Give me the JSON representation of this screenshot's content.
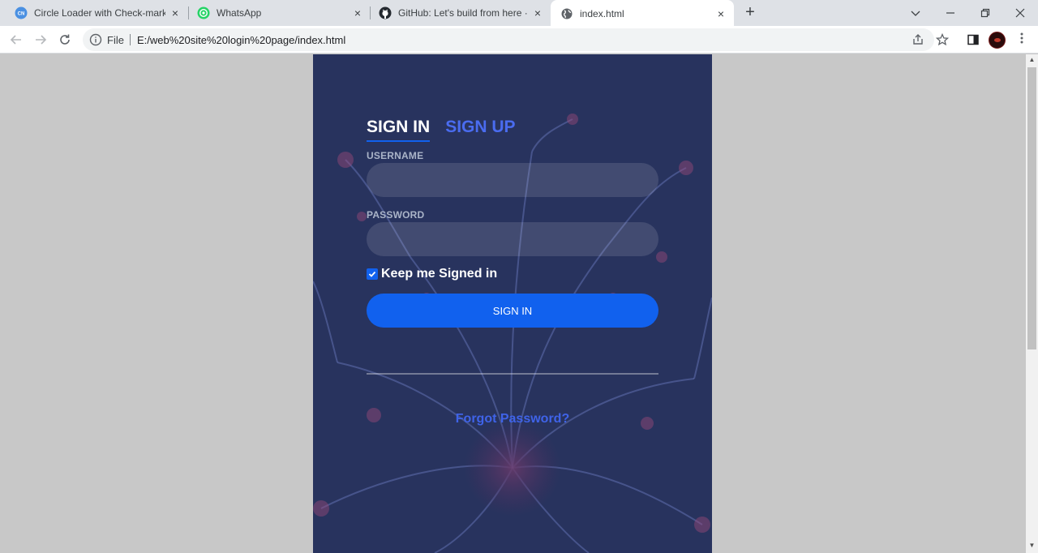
{
  "browser": {
    "tabs": [
      {
        "title": "Circle Loader with Check-mark A",
        "favicon": "codingnepal-icon",
        "close": "×"
      },
      {
        "title": "WhatsApp",
        "favicon": "whatsapp-icon",
        "close": "×"
      },
      {
        "title": "GitHub: Let's build from here · Gi",
        "favicon": "github-icon",
        "close": "×"
      },
      {
        "title": "index.html",
        "favicon": "globe-icon",
        "close": "×",
        "active": true
      }
    ],
    "new_tab": "+",
    "address": {
      "scheme_label": "File",
      "url": "E:/web%20site%20login%20page/index.html"
    }
  },
  "login": {
    "tabs": {
      "sign_in": "SIGN IN",
      "sign_up": "SIGN UP"
    },
    "username_label": "USERNAME",
    "username_value": "",
    "password_label": "PASSWORD",
    "password_value": "",
    "remember_label": "Keep me Signed in",
    "remember_checked": true,
    "submit_label": "SIGN IN",
    "forgot_label": "Forgot Password?"
  },
  "colors": {
    "card_bg": "#28335e",
    "accent": "#1161ee",
    "link": "#3f63e8"
  }
}
